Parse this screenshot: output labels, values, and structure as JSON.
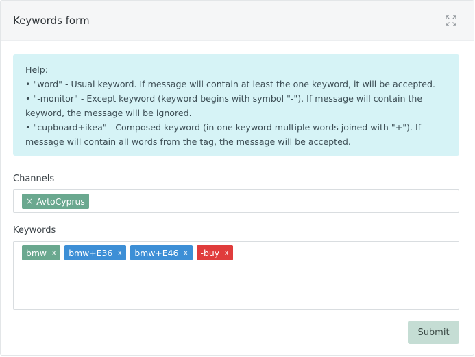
{
  "header": {
    "title": "Keywords form",
    "expand_icon": "expand-arrows-icon"
  },
  "help": {
    "title": "Help:",
    "items": [
      "• \"word\" - Usual keyword. If message will contain at least the one keyword, it will be accepted.",
      "• \"-monitor\" - Except keyword (keyword begins with symbol \"-\"). If message will contain the keyword, the message will be ignored.",
      "• \"cupboard+ikea\" - Composed keyword (in one keyword multiple words joined with \"+\"). If message will contain all words from the tag, the message will be accepted."
    ]
  },
  "channels": {
    "label": "Channels",
    "tags": [
      {
        "text": "AvtoCyprus",
        "remove": "×",
        "color": "#6aa88f"
      }
    ]
  },
  "keywords": {
    "label": "Keywords",
    "tags": [
      {
        "text": "bmw",
        "remove": "x",
        "color": "#6aa88f"
      },
      {
        "text": "bmw+E36",
        "remove": "x",
        "color": "#3d8fd6"
      },
      {
        "text": "bmw+E46",
        "remove": "x",
        "color": "#3d8fd6"
      },
      {
        "text": "-buy",
        "remove": "x",
        "color": "#e03c3c"
      }
    ]
  },
  "footer": {
    "submit_label": "Submit"
  }
}
